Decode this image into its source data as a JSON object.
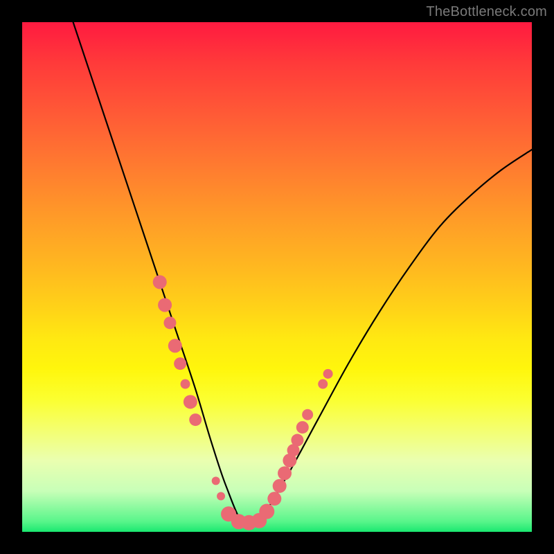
{
  "watermark": "TheBottleneck.com",
  "chart_data": {
    "type": "line",
    "title": "",
    "xlabel": "",
    "ylabel": "",
    "xlim": [
      0,
      100
    ],
    "ylim": [
      0,
      100
    ],
    "series": [
      {
        "name": "bottleneck-curve",
        "x": [
          10,
          14,
          18,
          22,
          26,
          30,
          34,
          37,
          40,
          43.5,
          47,
          52,
          58,
          64,
          70,
          76,
          82,
          88,
          94,
          100
        ],
        "y": [
          100,
          88,
          76,
          64,
          52,
          40,
          28,
          18,
          9,
          1.5,
          3,
          11,
          22,
          33,
          43,
          52,
          60,
          66,
          71,
          75
        ]
      }
    ],
    "markers": {
      "name": "highlight-dots",
      "color": "#ea6a74",
      "points": [
        {
          "x": 27.0,
          "y": 49.0,
          "r": 10
        },
        {
          "x": 28.0,
          "y": 44.5,
          "r": 10
        },
        {
          "x": 29.0,
          "y": 41.0,
          "r": 9
        },
        {
          "x": 30.0,
          "y": 36.5,
          "r": 10
        },
        {
          "x": 31.0,
          "y": 33.0,
          "r": 9
        },
        {
          "x": 32.0,
          "y": 29.0,
          "r": 7
        },
        {
          "x": 33.0,
          "y": 25.5,
          "r": 10
        },
        {
          "x": 34.0,
          "y": 22.0,
          "r": 9
        },
        {
          "x": 38.0,
          "y": 10.0,
          "r": 6
        },
        {
          "x": 39.0,
          "y": 7.0,
          "r": 6
        },
        {
          "x": 40.5,
          "y": 3.5,
          "r": 11
        },
        {
          "x": 42.5,
          "y": 2.0,
          "r": 11
        },
        {
          "x": 44.5,
          "y": 1.8,
          "r": 11
        },
        {
          "x": 46.5,
          "y": 2.2,
          "r": 11
        },
        {
          "x": 48.0,
          "y": 4.0,
          "r": 11
        },
        {
          "x": 49.5,
          "y": 6.5,
          "r": 10
        },
        {
          "x": 50.5,
          "y": 9.0,
          "r": 10
        },
        {
          "x": 51.5,
          "y": 11.5,
          "r": 10
        },
        {
          "x": 52.5,
          "y": 14.0,
          "r": 10
        },
        {
          "x": 53.2,
          "y": 16.0,
          "r": 9
        },
        {
          "x": 54.0,
          "y": 18.0,
          "r": 9
        },
        {
          "x": 55.0,
          "y": 20.5,
          "r": 9
        },
        {
          "x": 56.0,
          "y": 23.0,
          "r": 8
        },
        {
          "x": 59.0,
          "y": 29.0,
          "r": 7
        },
        {
          "x": 60.0,
          "y": 31.0,
          "r": 7
        }
      ]
    }
  }
}
